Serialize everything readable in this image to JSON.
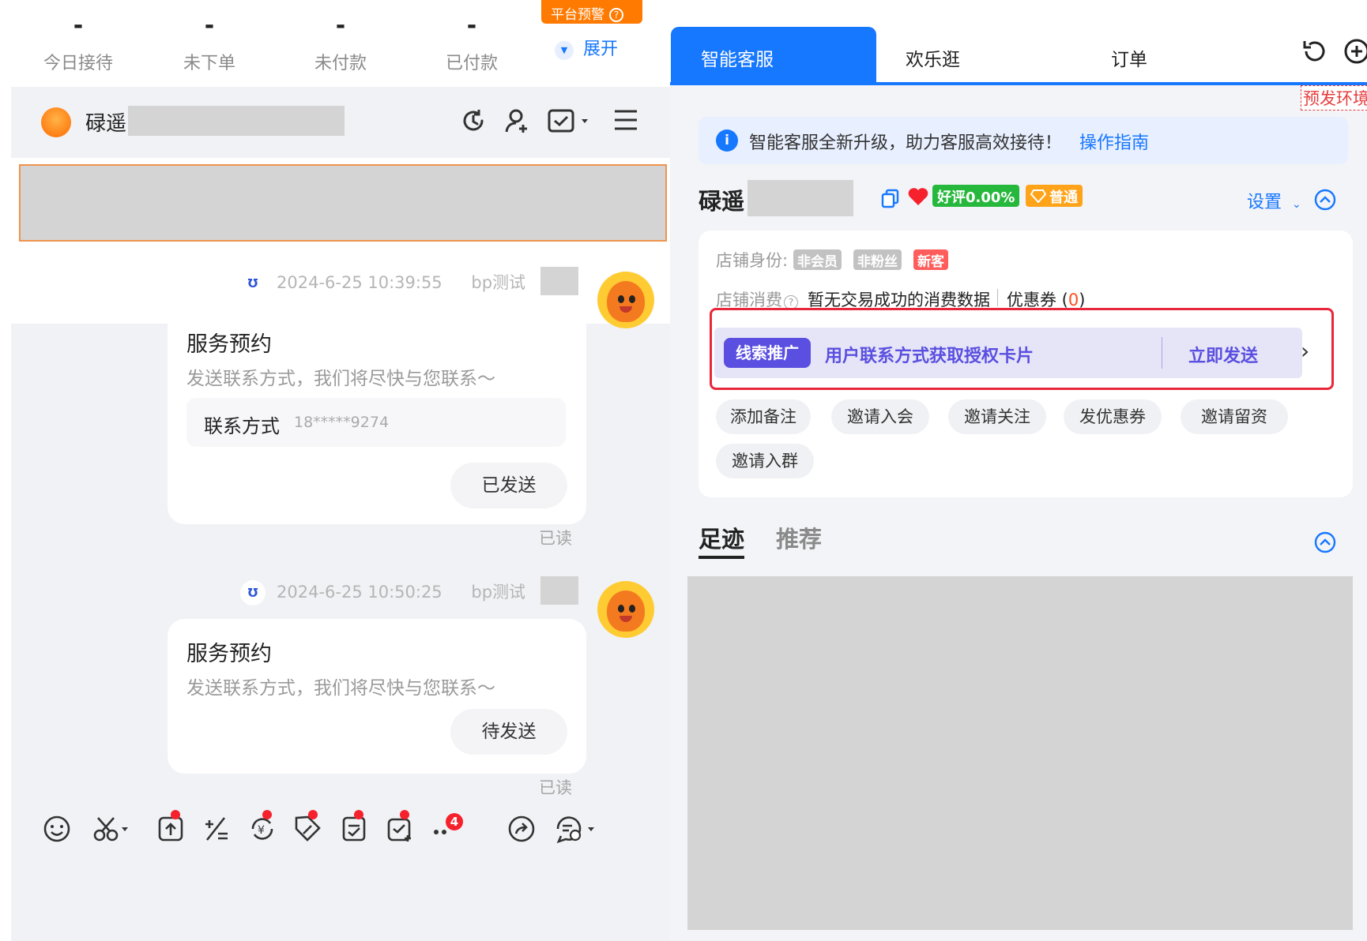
{
  "stats": [
    {
      "value": "-",
      "label": "今日接待"
    },
    {
      "value": "-",
      "label": "未下单"
    },
    {
      "value": "-",
      "label": "未付款"
    },
    {
      "value": "-",
      "label": "已付款"
    }
  ],
  "alert_badge": "平台预警",
  "alert_help": "?",
  "expand_label": "展开",
  "chat": {
    "user_name": "碌遥",
    "messages": [
      {
        "time": "2024-6-25 10:39:55",
        "sender": "bp测试",
        "title": "服务预约",
        "subtitle": "发送联系方式，我们将尽快与您联系～",
        "contact_label": "联系方式",
        "contact_value": "18*****9274",
        "button": "已发送",
        "read": "已读"
      },
      {
        "time": "2024-6-25 10:50:25",
        "sender": "bp测试",
        "title": "服务预约",
        "subtitle": "发送联系方式，我们将尽快与您联系～",
        "button": "待发送",
        "read": "已读"
      }
    ],
    "more_badge": "4"
  },
  "right": {
    "tabs": [
      "智能客服",
      "欢乐逛",
      "订单"
    ],
    "env_tag": "预发环境",
    "notice": {
      "text": "智能客服全新升级，助力客服高效接待！",
      "link": "操作指南"
    },
    "customer": {
      "name": "碌遥",
      "rating": "好评0.00%",
      "level": "普通",
      "settings": "设置"
    },
    "shop_identity_label": "店铺身份:",
    "identity_tags": [
      "非会员",
      "非粉丝",
      "新客"
    ],
    "consumption_label": "店铺消费",
    "consumption_text": "暂无交易成功的消费数据",
    "coupon_label": "优惠券 (",
    "coupon_count": "0",
    "coupon_close": ")",
    "lead": {
      "tag": "线索推广",
      "text": "用户联系方式获取授权卡片",
      "action": "立即发送"
    },
    "actions": [
      "添加备注",
      "邀请入会",
      "邀请关注",
      "发优惠券",
      "邀请留资",
      "邀请入群"
    ],
    "bottom_tabs": [
      "足迹",
      "推荐"
    ]
  },
  "colors": {
    "accent": "#1677ff",
    "lead": "#5a4fe0",
    "alert": "#ff7a00",
    "highlight_border": "#e8283a"
  }
}
